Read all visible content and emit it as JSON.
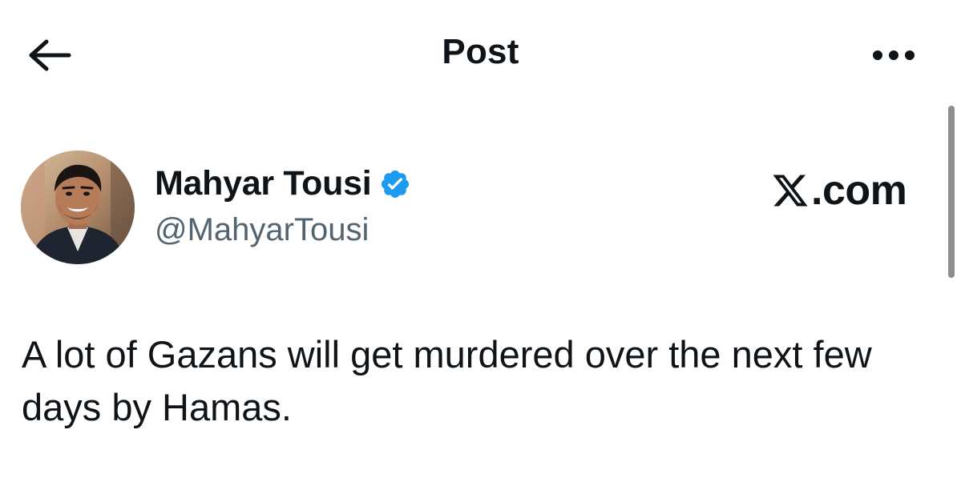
{
  "header": {
    "title": "Post",
    "back_icon": "arrow-left-icon",
    "more_icon": "more-horizontal-icon"
  },
  "post": {
    "author": {
      "display_name": "Mahyar Tousi",
      "handle": "@MahyarTousi",
      "verified": true,
      "verified_color": "#1d9bf0"
    },
    "text": "A lot of Gazans will get murdered over the next few days by Hamas."
  },
  "watermark": {
    "text": ".com",
    "logo_icon": "x-logo-icon"
  },
  "colors": {
    "text_primary": "#0f1419",
    "text_secondary": "#536471",
    "background": "#ffffff",
    "accent": "#1d9bf0"
  }
}
